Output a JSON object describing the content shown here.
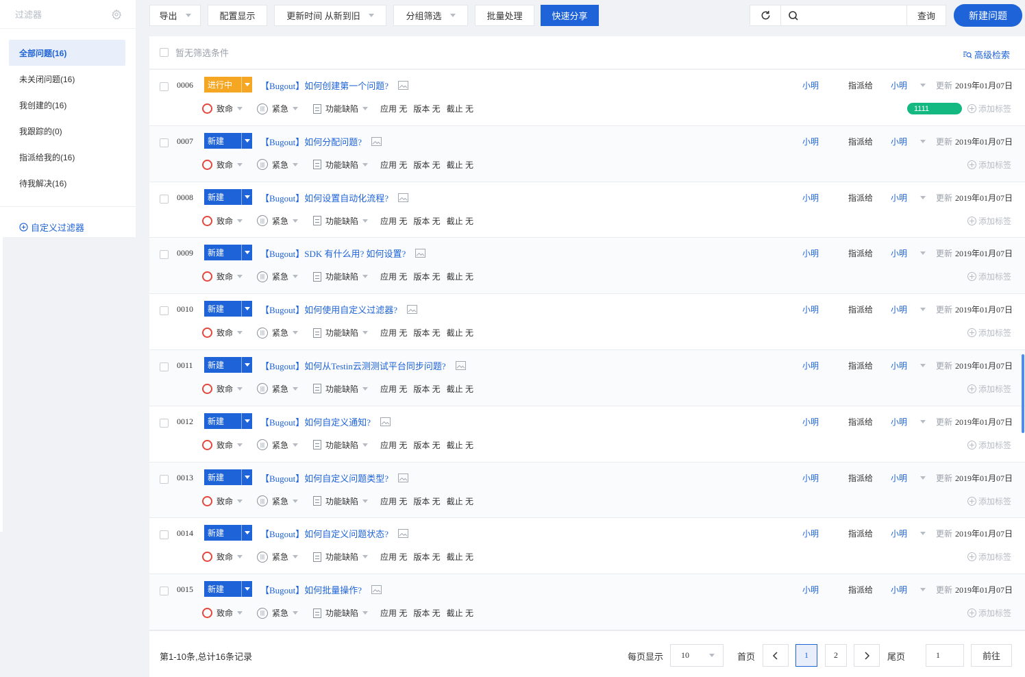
{
  "sidebar": {
    "title": "过滤器",
    "items": [
      {
        "label": "全部问题(16)",
        "active": true
      },
      {
        "label": "未关闭问题(16)"
      },
      {
        "label": "我创建的(16)"
      },
      {
        "label": "我跟踪的(0)"
      },
      {
        "label": "指派给我的(16)"
      },
      {
        "label": "待我解决(16)"
      }
    ],
    "custom_filter": "自定义过滤器"
  },
  "toolbar": {
    "export": "导出",
    "config": "配置显示",
    "sort": "更新时间 从新到旧",
    "group": "分组筛选",
    "batch": "批量处理",
    "share": "快速分享",
    "search_placeholder": "",
    "query": "查询",
    "new_issue": "新建问题"
  },
  "filter": {
    "empty": "暂无筛选条件",
    "advanced": "高级检索"
  },
  "labels": {
    "assign": "指派给",
    "updated": "更新",
    "severity": "致命",
    "priority": "紧急",
    "type": "功能缺陷",
    "app": "应用 无",
    "version": "版本 无",
    "deadline": "截止 无",
    "add_tag": "添加标签"
  },
  "colors": {
    "accent": "#1e63d8",
    "in_progress": "#f5a623",
    "new": "#1e63d8",
    "tag": "#13b980"
  },
  "issues": [
    {
      "id": "0006",
      "status": "进行中",
      "status_type": "in_progress",
      "title": "【Bugout】如何创建第一个问题?",
      "owner": "小明",
      "assignee": "小明",
      "updated": "2019年01月07日",
      "tag": "1111"
    },
    {
      "id": "0007",
      "status": "新建",
      "status_type": "new",
      "title": "【Bugout】如何分配问题?",
      "owner": "小明",
      "assignee": "小明",
      "updated": "2019年01月07日"
    },
    {
      "id": "0008",
      "status": "新建",
      "status_type": "new",
      "title": "【Bugout】如何设置自动化流程?",
      "owner": "小明",
      "assignee": "小明",
      "updated": "2019年01月07日"
    },
    {
      "id": "0009",
      "status": "新建",
      "status_type": "new",
      "title": "【Bugout】SDK 有什么用? 如何设置?",
      "owner": "小明",
      "assignee": "小明",
      "updated": "2019年01月07日"
    },
    {
      "id": "0010",
      "status": "新建",
      "status_type": "new",
      "title": "【Bugout】如何使用自定义过滤器?",
      "owner": "小明",
      "assignee": "小明",
      "updated": "2019年01月07日"
    },
    {
      "id": "0011",
      "status": "新建",
      "status_type": "new",
      "title": "【Bugout】如何从Testin云测测试平台同步问题?",
      "owner": "小明",
      "assignee": "小明",
      "updated": "2019年01月07日"
    },
    {
      "id": "0012",
      "status": "新建",
      "status_type": "new",
      "title": "【Bugout】如何自定义通知?",
      "owner": "小明",
      "assignee": "小明",
      "updated": "2019年01月07日"
    },
    {
      "id": "0013",
      "status": "新建",
      "status_type": "new",
      "title": "【Bugout】如何自定义问题类型?",
      "owner": "小明",
      "assignee": "小明",
      "updated": "2019年01月07日"
    },
    {
      "id": "0014",
      "status": "新建",
      "status_type": "new",
      "title": "【Bugout】如何自定义问题状态?",
      "owner": "小明",
      "assignee": "小明",
      "updated": "2019年01月07日"
    },
    {
      "id": "0015",
      "status": "新建",
      "status_type": "new",
      "title": "【Bugout】如何批量操作?",
      "owner": "小明",
      "assignee": "小明",
      "updated": "2019年01月07日"
    }
  ],
  "pagination": {
    "summary": "第1-10条,总计16条记录",
    "per_page_label": "每页显示",
    "per_page": "10",
    "first": "首页",
    "pages": [
      "1",
      "2"
    ],
    "current": "1",
    "last": "尾页",
    "goto_value": "1",
    "goto": "前往"
  }
}
